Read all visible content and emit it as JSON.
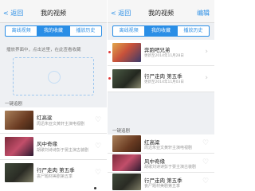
{
  "left": {
    "nav": {
      "back": "< 返回",
      "title": "我的视频"
    },
    "tabs": [
      "离线视频",
      "我的收藏",
      "播放历史"
    ],
    "active_tab": 1,
    "hint": "播放界面中，点击这里，在此查看收藏",
    "section": "一键追剧",
    "recommendations": [
      {
        "title": "红高粱",
        "desc": "周迅朱亚文黄轩主演电视剧"
      },
      {
        "title": "风中奇缘",
        "desc": "胡歌刘诗诗彭于晏主演古装剧"
      },
      {
        "title": "行尸走肉 第五季",
        "desc": "丧尸题材美剧第五季"
      }
    ]
  },
  "right": {
    "nav": {
      "back": "< 返回",
      "title": "我的视频",
      "edit": "编辑"
    },
    "tabs": [
      "离线视频",
      "我的收藏",
      "播放历史"
    ],
    "active_tab": 1,
    "favorites": [
      {
        "title": "奔跑吧兄弟",
        "sub": "更新至2014年11月28日"
      },
      {
        "title": "行尸走肉 第五季",
        "sub": "更新至2014年11月03日"
      }
    ],
    "section": "一键追剧",
    "recommendations": [
      {
        "title": "红高粱",
        "desc": "周迅朱亚文黄轩主演电视剧"
      },
      {
        "title": "风中奇缘",
        "desc": "胡歌刘诗诗彭于晏主演古装剧"
      },
      {
        "title": "行尸走肉 第五季",
        "desc": "丧尸题材美剧第五季"
      }
    ]
  },
  "colors": {
    "accent": "#2a8ee6",
    "background": "#eef0f3",
    "dot": "#e03a3a"
  }
}
